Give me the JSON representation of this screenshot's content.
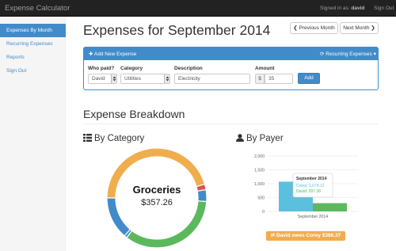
{
  "navbar": {
    "brand": "Expense Calculator",
    "signed_in_label": "Signed in as:",
    "signed_in_user": "david",
    "sign_out": "Sign Out"
  },
  "sidebar": {
    "items": [
      {
        "label": "Expenses By Month",
        "active": true
      },
      {
        "label": "Recurring Expenses",
        "active": false
      },
      {
        "label": "Reports",
        "active": false
      },
      {
        "label": "Sign Out",
        "active": false
      }
    ]
  },
  "page": {
    "title": "Expenses for September 2014",
    "prev_month": "Previous Month",
    "next_month": "Next Month"
  },
  "add_panel": {
    "heading": "Add New Expense",
    "recurring": "Recurring Expenses",
    "labels": {
      "who": "Who paid?",
      "category": "Category",
      "description": "Description",
      "amount": "Amount"
    },
    "who_value": "David",
    "category_value": "Utilities",
    "description_value": "Electricity",
    "currency_symbol": "$",
    "amount_value": "35",
    "add_button": "Add"
  },
  "breakdown": {
    "title": "Expense Breakdown",
    "by_category": "By Category",
    "by_payer": "By Payer",
    "donut_center_name": "Groceries",
    "donut_center_value": "$357.26",
    "owes_text": "David owes Corey $386.37"
  },
  "colors": {
    "primary": "#428bca",
    "orange": "#f0ad4e",
    "green": "#5cb85c",
    "red": "#d9534f",
    "light_blue": "#5bc0de"
  },
  "chart_data": [
    {
      "type": "pie",
      "variant": "donut",
      "slices": [
        {
          "value": 357.26,
          "color": "#f0ad4e"
        },
        {
          "value": 14,
          "color": "#d9534f"
        },
        {
          "value": 30,
          "color": "#428bca"
        },
        {
          "value": 268,
          "color": "#5cb85c"
        },
        {
          "value": 7,
          "color": "#428bca"
        },
        {
          "value": 108,
          "color": "#428bca"
        }
      ]
    },
    {
      "type": "bar",
      "categories": [
        "September 2014"
      ],
      "series": [
        {
          "name": "Corey",
          "values": [
            1074.12
          ],
          "color": "#5bc0de"
        },
        {
          "name": "David",
          "values": [
            297.38
          ],
          "color": "#5cb85c"
        }
      ],
      "ylim": [
        0,
        2000
      ],
      "yticks": [
        0,
        500,
        "1,000",
        "1,500",
        "2,000"
      ],
      "tooltip": {
        "title": "September 2014",
        "lines": [
          "Corey: 1,074.12",
          "David: 297.38"
        ]
      }
    }
  ]
}
